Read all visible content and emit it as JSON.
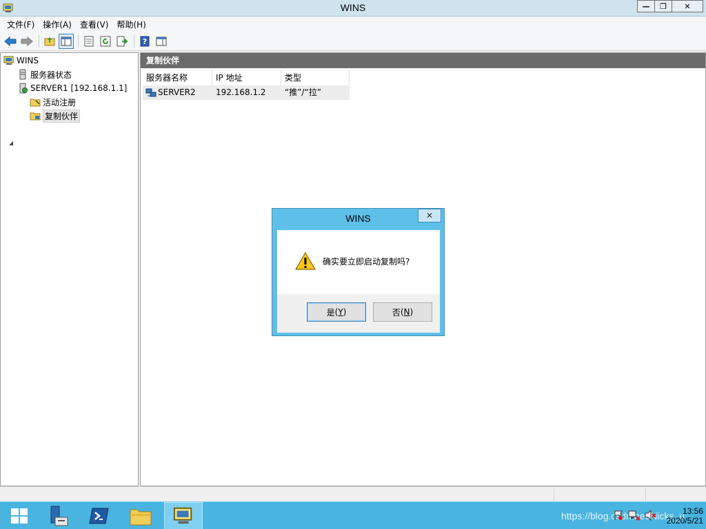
{
  "window": {
    "title": "WINS"
  },
  "menu": [
    "文件(F)",
    "操作(A)",
    "查看(V)",
    "帮助(H)"
  ],
  "tree": {
    "root": "WINS",
    "items": [
      {
        "label": "服务器状态"
      },
      {
        "label": "SERVER1 [192.168.1.1]"
      },
      {
        "label": "活动注册"
      },
      {
        "label": "复制伙伴"
      }
    ]
  },
  "main": {
    "header": "复制伙伴",
    "columns": [
      "服务器名称",
      "IP 地址",
      "类型"
    ],
    "rows": [
      {
        "name": "SERVER2",
        "ip": "192.168.1.2",
        "type": "“推”/“拉”"
      }
    ]
  },
  "dialog": {
    "title": "WINS",
    "message": "确实要立即启动复制吗?",
    "yes_label": "是",
    "yes_key": "Y",
    "no_label": "否",
    "no_key": "N"
  },
  "taskbar": {
    "time": "13:56",
    "date": "2020/5/21",
    "watermark": "https://blog.csdn.net/Nicks_u"
  },
  "colors": {
    "taskbar": "#4ab4e0",
    "dialog_frame": "#5ec0e8",
    "pane_header": "#6b6b6b"
  }
}
